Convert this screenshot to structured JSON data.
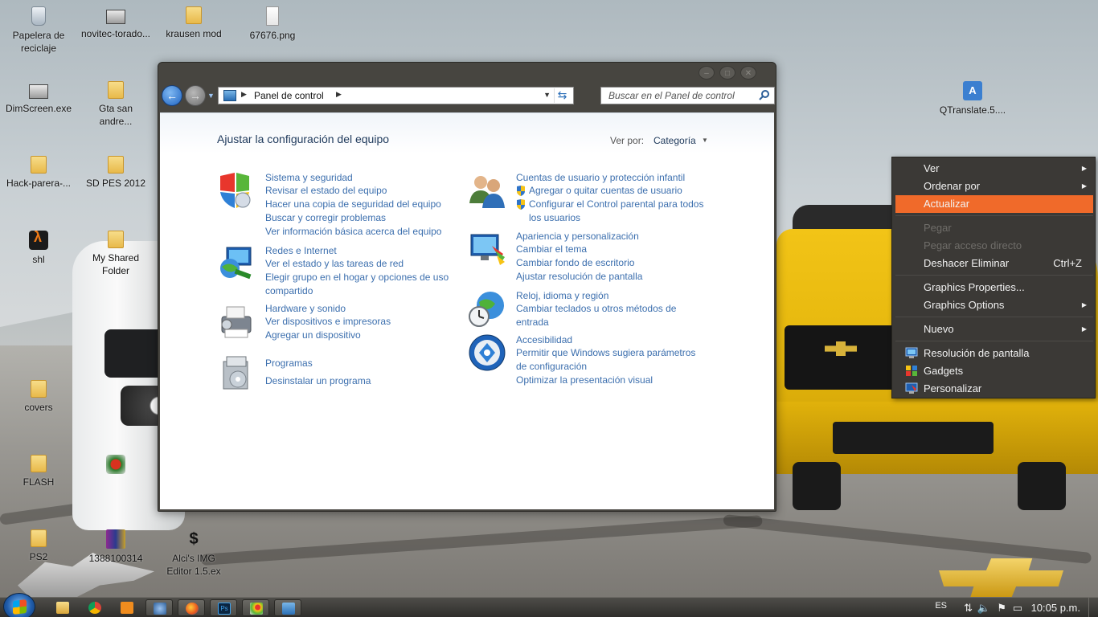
{
  "desktop": {
    "icons": [
      {
        "label": "Papelera de\nreciclaje",
        "icon": "recycle-bin-icon"
      },
      {
        "label": "novitec-torado...",
        "icon": "image-file-icon"
      },
      {
        "label": "krausen mod",
        "icon": "folder-icon"
      },
      {
        "label": "67676.png",
        "icon": "image-file-icon"
      },
      {
        "label": "DimScreen.exe",
        "icon": "exe-icon"
      },
      {
        "label": "Gta san\nandre...",
        "icon": "folder-icon"
      },
      {
        "label": "Hack-parera-...",
        "icon": "folder-icon"
      },
      {
        "label": "SD PES 2012",
        "icon": "folder-icon"
      },
      {
        "label": "shl",
        "icon": "half-life-icon"
      },
      {
        "label": "My Shared\nFolder",
        "icon": "folder-icon"
      },
      {
        "label": "covers",
        "icon": "folder-icon"
      },
      {
        "label": "FLASH",
        "icon": "folder-icon"
      },
      {
        "label": "PS2",
        "icon": "folder-icon"
      },
      {
        "label": "1388100314",
        "icon": "winrar-icon"
      },
      {
        "label": "Alci's IMG\nEditor 1.5.ex",
        "icon": "img-editor-icon"
      },
      {
        "label": "QTranslate.5....",
        "icon": "qtranslate-icon"
      }
    ]
  },
  "window": {
    "address": {
      "crumb": "Panel de control"
    },
    "search": {
      "placeholder": "Buscar en el Panel de control"
    },
    "title": "Ajustar la configuración del equipo",
    "view_by_label": "Ver por:",
    "view_by_value": "Categoría",
    "categories": [
      {
        "heading": "Sistema y seguridad",
        "icon": "security-shield-icon",
        "links": [
          "Revisar el estado del equipo",
          "Hacer una copia de seguridad del equipo",
          "Buscar y corregir problemas",
          "Ver información básica acerca del equipo"
        ]
      },
      {
        "heading": "Redes e Internet",
        "icon": "network-globe-icon",
        "links": [
          "Ver el estado y las tareas de red",
          "Elegir grupo en el hogar y opciones de uso compartido"
        ]
      },
      {
        "heading": "Hardware y sonido",
        "icon": "printer-icon",
        "links": [
          "Ver dispositivos e impresoras",
          "Agregar un dispositivo"
        ]
      },
      {
        "heading": "Programas",
        "icon": "programs-box-icon",
        "links": [
          "Desinstalar un programa"
        ]
      },
      {
        "heading": "Cuentas de usuario y protección infantil",
        "icon": "users-icon",
        "links": [
          "Agregar o quitar cuentas de usuario",
          "Configurar el Control parental para todos los usuarios"
        ]
      },
      {
        "heading": "Apariencia y personalización",
        "icon": "monitor-paint-icon",
        "links": [
          "Cambiar el tema",
          "Cambiar fondo de escritorio",
          "Ajustar resolución de pantalla"
        ]
      },
      {
        "heading": "Reloj, idioma y región",
        "icon": "clock-globe-icon",
        "links": [
          "Cambiar teclados u otros métodos de entrada"
        ]
      },
      {
        "heading": "Accesibilidad",
        "icon": "accessibility-icon",
        "links": [
          "Permitir que Windows sugiera parámetros de configuración",
          "Optimizar la presentación visual"
        ]
      }
    ]
  },
  "context_menu": {
    "items": [
      {
        "label": "Ver",
        "submenu": true
      },
      {
        "label": "Ordenar por",
        "submenu": true
      },
      {
        "label": "Actualizar",
        "highlighted": true
      },
      {
        "label": "Pegar",
        "disabled": true
      },
      {
        "label": "Pegar acceso directo",
        "disabled": true
      },
      {
        "label": "Deshacer Eliminar",
        "shortcut": "Ctrl+Z"
      },
      {
        "label": "Graphics Properties..."
      },
      {
        "label": "Graphics Options",
        "submenu": true
      },
      {
        "label": "Nuevo",
        "submenu": true
      },
      {
        "label": "Resolución de pantalla",
        "icon": "screen-resolution-icon"
      },
      {
        "label": "Gadgets",
        "icon": "gadgets-icon"
      },
      {
        "label": "Personalizar",
        "icon": "personalize-icon"
      }
    ],
    "highlight_color": "#f06a2a"
  },
  "taskbar": {
    "apps": [
      "file-explorer-icon",
      "chrome-icon",
      "media-player-icon",
      "settings-tool-icon",
      "firefox-icon",
      "photoshop-icon",
      "paint-icon",
      "control-panel-icon"
    ],
    "language": "ES",
    "clock": "10:05 p.m."
  }
}
